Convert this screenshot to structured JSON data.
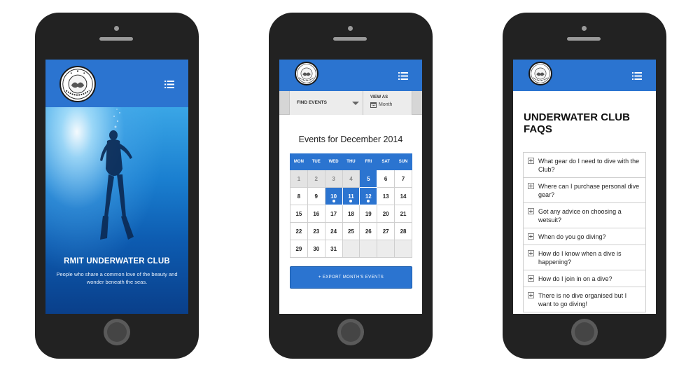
{
  "colors": {
    "brand_blue": "#2b74d0",
    "phone_body": "#222222"
  },
  "icons": {
    "menu": "hamburger-list-icon",
    "calendar": "calendar-icon",
    "expand": "plus-box-icon",
    "caret": "caret-down-icon"
  },
  "phone1": {
    "hero_title": "RMIT UNDERWATER CLUB",
    "hero_subtitle": "People who share a common love of the beauty and wonder beneath the seas."
  },
  "phone2": {
    "find_events_label": "FIND EVENTS",
    "view_as_label": "VIEW AS",
    "view_as_value": "Month",
    "calendar_title": "Events for December 2014",
    "weekdays": [
      "MON",
      "TUE",
      "WED",
      "THU",
      "FRI",
      "SAT",
      "SUN"
    ],
    "weeks": [
      [
        {
          "d": "1",
          "s": "past"
        },
        {
          "d": "2",
          "s": "past"
        },
        {
          "d": "3",
          "s": "past"
        },
        {
          "d": "4",
          "s": "past"
        },
        {
          "d": "5",
          "s": "event"
        },
        {
          "d": "6",
          "s": ""
        },
        {
          "d": "7",
          "s": ""
        }
      ],
      [
        {
          "d": "8",
          "s": ""
        },
        {
          "d": "9",
          "s": ""
        },
        {
          "d": "10",
          "s": "event-dot"
        },
        {
          "d": "11",
          "s": "event-dot"
        },
        {
          "d": "12",
          "s": "event-dot"
        },
        {
          "d": "13",
          "s": ""
        },
        {
          "d": "14",
          "s": ""
        }
      ],
      [
        {
          "d": "15",
          "s": ""
        },
        {
          "d": "16",
          "s": ""
        },
        {
          "d": "17",
          "s": ""
        },
        {
          "d": "18",
          "s": ""
        },
        {
          "d": "19",
          "s": ""
        },
        {
          "d": "20",
          "s": ""
        },
        {
          "d": "21",
          "s": ""
        }
      ],
      [
        {
          "d": "22",
          "s": ""
        },
        {
          "d": "23",
          "s": ""
        },
        {
          "d": "24",
          "s": ""
        },
        {
          "d": "25",
          "s": ""
        },
        {
          "d": "26",
          "s": ""
        },
        {
          "d": "27",
          "s": ""
        },
        {
          "d": "28",
          "s": ""
        }
      ],
      [
        {
          "d": "29",
          "s": ""
        },
        {
          "d": "30",
          "s": ""
        },
        {
          "d": "31",
          "s": ""
        },
        {
          "d": "",
          "s": "blank"
        },
        {
          "d": "",
          "s": "blank"
        },
        {
          "d": "",
          "s": "blank"
        },
        {
          "d": "",
          "s": "blank"
        }
      ]
    ],
    "export_button": "+ EXPORT MONTH'S EVENTS"
  },
  "phone3": {
    "title": "UNDERWATER CLUB FAQS",
    "faqs": [
      "What gear do I need to dive with the Club?",
      "Where can I purchase personal dive gear?",
      "Got any advice on choosing a wetsuit?",
      "When do you go diving?",
      "How do I know when a dive is happening?",
      "How do I join in on a dive?",
      "There is no dive organised but I want to go diving!"
    ]
  }
}
